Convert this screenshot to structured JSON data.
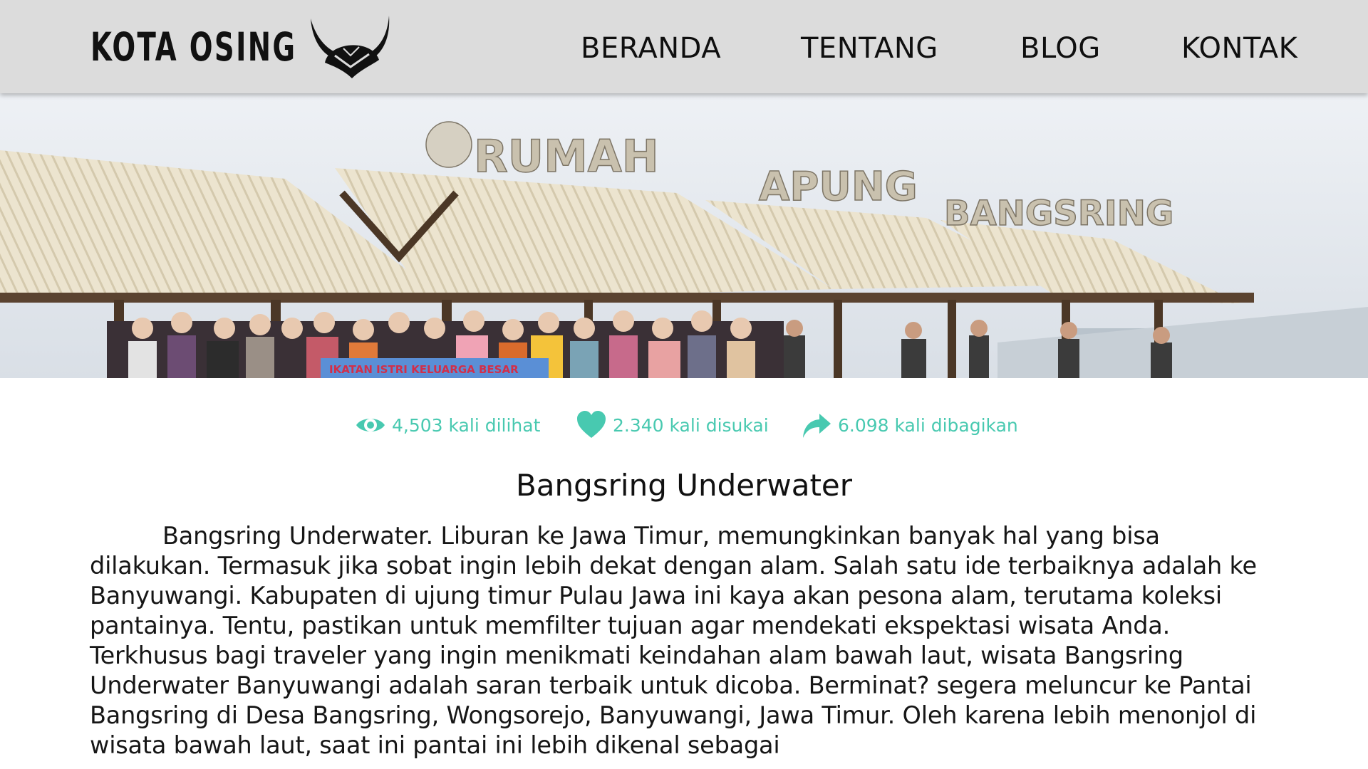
{
  "brand": {
    "name": "KOTA OSING",
    "logo_icon": "horned-helmet-icon"
  },
  "nav": {
    "items": [
      {
        "label": "BERANDA"
      },
      {
        "label": "TENTANG"
      },
      {
        "label": "BLOG"
      },
      {
        "label": "KONTAK"
      }
    ]
  },
  "hero": {
    "sign_words": [
      "RUMAH",
      "APUNG",
      "BANGSRING"
    ],
    "banner_text": "IKATAN ISTRI KELUARGA BESAR"
  },
  "stats": {
    "views": {
      "icon": "eye-icon",
      "text": "4,503 kali dilihat"
    },
    "likes": {
      "icon": "heart-icon",
      "text": "2.340 kali disukai"
    },
    "shares": {
      "icon": "share-arrow-icon",
      "text": "6.098 kali dibagikan"
    },
    "color": "#48c9b0"
  },
  "article": {
    "title": "Bangsring Underwater",
    "body": "Bangsring Underwater. Liburan ke Jawa Timur, memungkinkan banyak hal yang bisa dilakukan. Termasuk jika sobat ingin lebih dekat dengan alam. Salah satu ide terbaiknya adalah ke Banyuwangi. Kabupaten di ujung timur Pulau Jawa ini kaya akan pesona alam, terutama koleksi pantainya. Tentu, pastikan untuk memfilter tujuan agar mendekati ekspektasi wisata Anda. Terkhusus bagi traveler yang ingin menikmati keindahan alam bawah laut, wisata Bangsring Underwater Banyuwangi adalah saran terbaik untuk dicoba. Berminat? segera meluncur ke Pantai Bangsring di Desa Bangsring, Wongsorejo, Banyuwangi, Jawa Timur. Oleh karena lebih menonjol di wisata bawah laut, saat ini pantai ini lebih dikenal sebagai"
  },
  "colors": {
    "header_bg": "#dcdcdc",
    "accent": "#48c9b0"
  }
}
